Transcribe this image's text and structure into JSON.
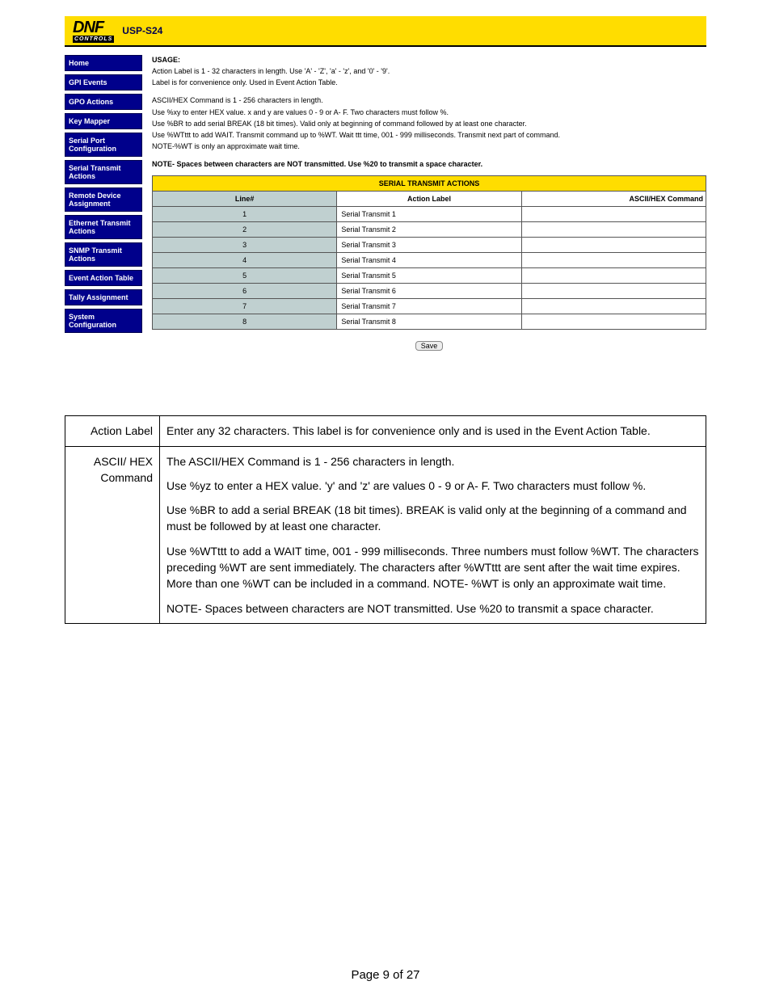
{
  "header": {
    "logo_big": "DNF",
    "logo_small": "CONTROLS",
    "product": "USP-S24"
  },
  "sidebar": {
    "items": [
      {
        "label": "Home"
      },
      {
        "label": "GPI Events"
      },
      {
        "label": "GPO Actions"
      },
      {
        "label": "Key Mapper"
      },
      {
        "label": "Serial Port Configuration"
      },
      {
        "label": "Serial Transmit Actions"
      },
      {
        "label": "Remote Device Assignment"
      },
      {
        "label": "Ethernet Transmit Actions"
      },
      {
        "label": "SNMP Transmit Actions"
      },
      {
        "label": "Event Action Table"
      },
      {
        "label": "Tally Assignment"
      },
      {
        "label": "System Configuration"
      }
    ]
  },
  "usage": {
    "title": "USAGE:",
    "line1": "Action Label is 1 - 32 characters in length. Use 'A' - 'Z', 'a' - 'z', and '0' - '9'.",
    "line2": "Label is for convenience only. Used in Event Action Table.",
    "line3": "ASCII/HEX Command is 1 - 256 characters in length.",
    "line4": "Use %xy to enter HEX value. x and y are values 0 - 9 or A- F. Two characters must follow %.",
    "line5": "Use %BR to add serial BREAK (18 bit times). Valid only at beginning of command followed by at least one character.",
    "line6": "Use %WTttt to add WAIT. Transmit command up to %WT. Wait ttt time, 001 - 999 milliseconds. Transmit next part of command.",
    "line7": "NOTE-%WT is only an approximate wait time.",
    "line8": "NOTE- Spaces between characters are NOT transmitted. Use %20 to transmit a space character."
  },
  "serial_table": {
    "caption": "SERIAL TRANSMIT ACTIONS",
    "col1": "Line#",
    "col2": "Action Label",
    "col3": "ASCII/HEX Command",
    "rows": [
      {
        "n": "1",
        "label": "Serial Transmit 1",
        "cmd": ""
      },
      {
        "n": "2",
        "label": "Serial Transmit 2",
        "cmd": ""
      },
      {
        "n": "3",
        "label": "Serial Transmit 3",
        "cmd": ""
      },
      {
        "n": "4",
        "label": "Serial Transmit 4",
        "cmd": ""
      },
      {
        "n": "5",
        "label": "Serial Transmit 5",
        "cmd": ""
      },
      {
        "n": "6",
        "label": "Serial Transmit 6",
        "cmd": ""
      },
      {
        "n": "7",
        "label": "Serial Transmit 7",
        "cmd": ""
      },
      {
        "n": "8",
        "label": "Serial Transmit 8",
        "cmd": ""
      }
    ],
    "save": "Save"
  },
  "desc_table": {
    "row1_left": "Action Label",
    "row1_right": "Enter any 32 characters.  This label is for convenience only and is used in the Event Action Table.",
    "row2_left": "ASCII/ HEX Command",
    "row2_p1": "The ASCII/HEX Command is 1 - 256 characters in length.",
    "row2_p2": "Use %yz to enter a HEX value.  'y' and 'z' are values 0 - 9 or A- F. Two characters must follow %.",
    "row2_p3": "Use %BR to add a serial BREAK (18 bit times).  BREAK is valid only at the beginning of a command and must be followed by at least one character.",
    "row2_p4": "Use %WTttt to add a WAIT time, 001 - 999 milliseconds.   Three numbers must follow %WT.  The characters preceding %WT are sent immediately.  The characters after %WTttt are sent after the wait time expires.   More than one %WT can be included in a command.  NOTE- %WT is only an approximate wait time.",
    "row2_p5": "NOTE- Spaces between characters are NOT transmitted. Use %20 to transmit a space character."
  },
  "footer": {
    "page_number": "Page 9 of 27"
  }
}
